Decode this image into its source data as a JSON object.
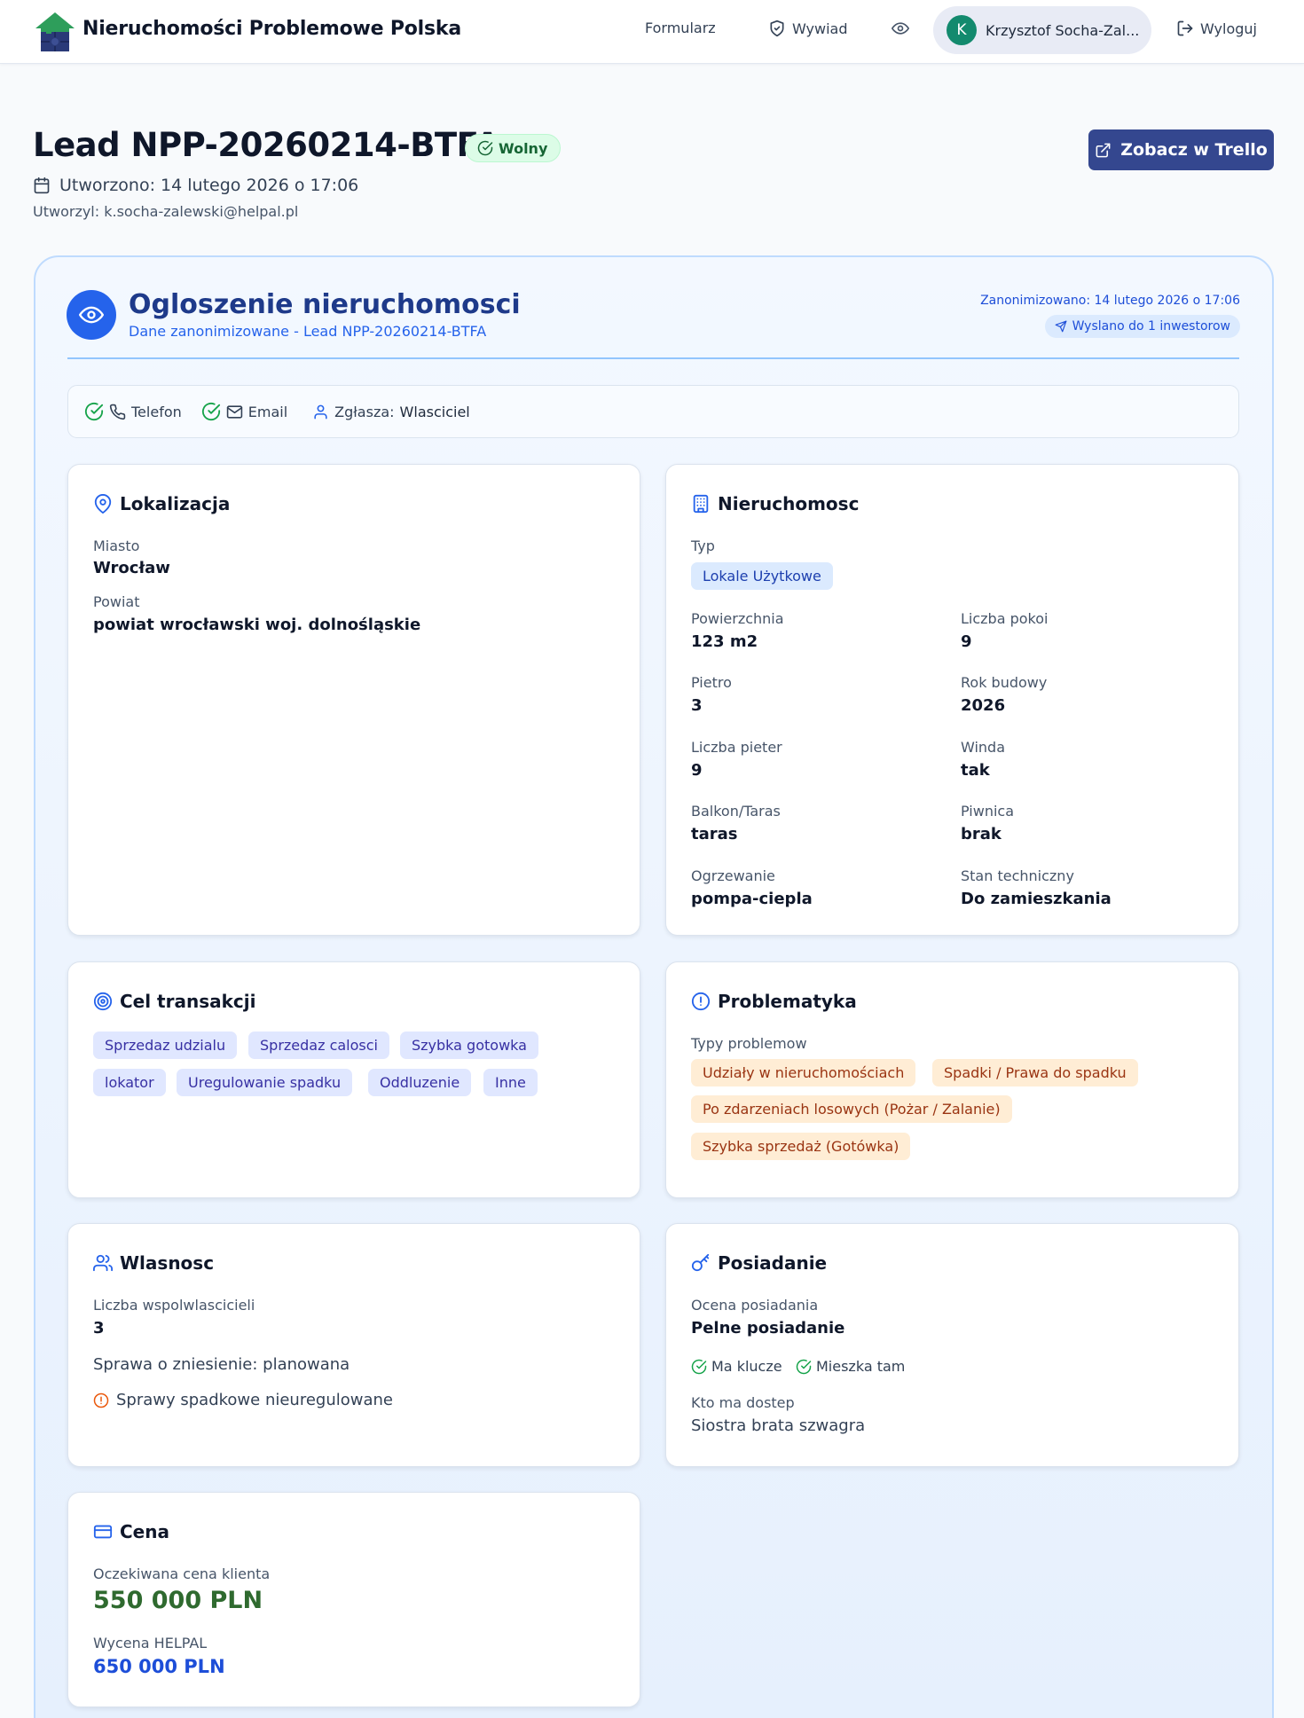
{
  "nav": {
    "brand": "Nieruchomości Problemowe Polska",
    "formularz": "Formularz",
    "wywiad": "Wywiad",
    "user_initial": "K",
    "user_name": "Krzysztof Socha-Zal...",
    "logout": "Wyloguj"
  },
  "header": {
    "title": "Lead NPP-20260214-BTFA",
    "status": "Wolny",
    "created": "Utworzono: 14 lutego 2026 o 17:06",
    "author": "Utworzyl: k.socha-zalewski@helpal.pl",
    "trello_button": "Zobacz w Trello"
  },
  "listing": {
    "title": "Ogloszenie nieruchomosci",
    "subtitle": "Dane zanonimizowane - Lead NPP-20260214-BTFA",
    "anonymized": "Zanonimizowano: 14 lutego 2026 o 17:06",
    "sent": "Wyslano do 1 inwestorow",
    "contact": {
      "phone": "Telefon",
      "email": "Email",
      "reporter_label": "Zgłasza:",
      "reporter_value": "Wlasciciel"
    }
  },
  "location": {
    "title": "Lokalizacja",
    "city_label": "Miasto",
    "city": "Wrocław",
    "county_label": "Powiat",
    "county": "powiat wrocławski woj. dolnośląskie"
  },
  "property": {
    "title": "Nieruchomosc",
    "type_label": "Typ",
    "type": "Lokale Użytkowe",
    "fields": [
      {
        "label": "Powierzchnia",
        "value": "123 m2"
      },
      {
        "label": "Liczba pokoi",
        "value": "9"
      },
      {
        "label": "Pietro",
        "value": "3"
      },
      {
        "label": "Rok budowy",
        "value": "2026"
      },
      {
        "label": "Liczba pieter",
        "value": "9"
      },
      {
        "label": "Winda",
        "value": "tak"
      },
      {
        "label": "Balkon/Taras",
        "value": "taras"
      },
      {
        "label": "Piwnica",
        "value": "brak"
      },
      {
        "label": "Ogrzewanie",
        "value": "pompa-ciepla"
      },
      {
        "label": "Stan techniczny",
        "value": "Do zamieszkania"
      }
    ]
  },
  "goal": {
    "title": "Cel transakcji",
    "tags": [
      "Sprzedaz udzialu",
      "Sprzedaz calosci",
      "Szybka gotowka",
      "lokator",
      "Uregulowanie spadku",
      "Oddluzenie",
      "Inne"
    ]
  },
  "problems": {
    "title": "Problematyka",
    "types_label": "Typy problemow",
    "tags": [
      "Udziały w nieruchomościach",
      "Spadki / Prawa do spadku",
      "Po zdarzeniach losowych (Pożar / Zalanie)",
      "Szybka sprzedaż (Gotówka)"
    ]
  },
  "ownership": {
    "title": "Wlasnosc",
    "co_owners_label": "Liczba wspolwlascicieli",
    "co_owners": "3",
    "case_status": "Sprawa o zniesienie: planowana",
    "inheritance_warning": "Sprawy spadkowe nieuregulowane"
  },
  "possession": {
    "title": "Posiadanie",
    "assessment_label": "Ocena posiadania",
    "assessment": "Pelne posiadanie",
    "has_keys": "Ma klucze",
    "lives_there": "Mieszka tam",
    "access_label": "Kto ma dostep",
    "access": "Siostra brata szwagra"
  },
  "price": {
    "title": "Cena",
    "expected_label": "Oczekiwana cena klienta",
    "expected": "550 000 PLN",
    "helpal_label": "Wycena HELPAL",
    "helpal": "650 000 PLN"
  },
  "colors": {
    "primary": "#2563eb",
    "button": "#34478f",
    "success": "#16a34a",
    "warning": "#ea580c"
  }
}
